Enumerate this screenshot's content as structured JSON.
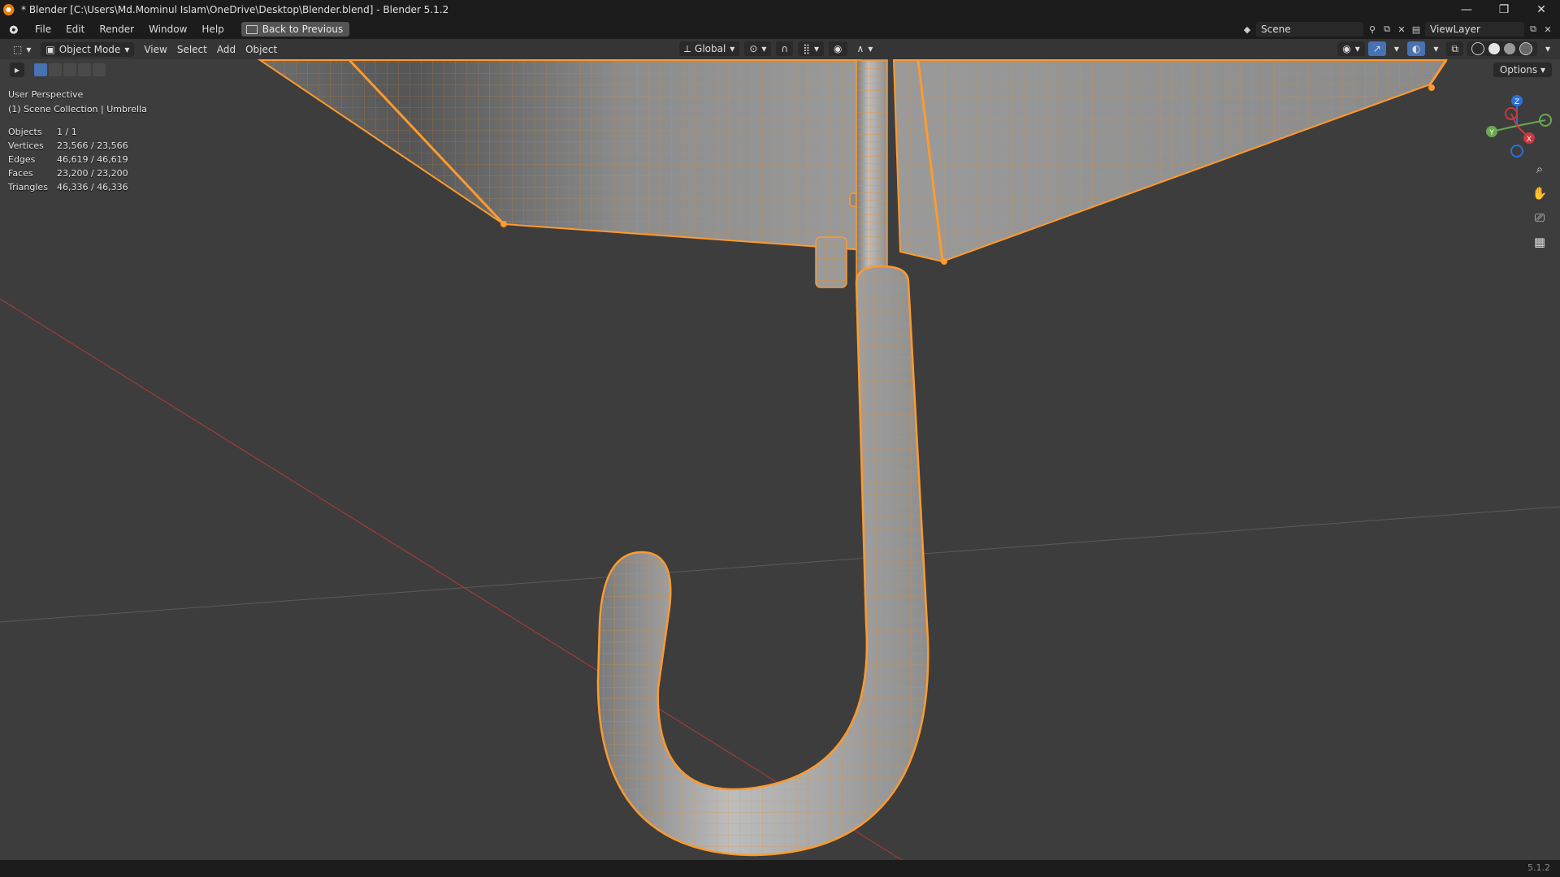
{
  "window": {
    "title": "* Blender [C:\\Users\\Md.Mominul Islam\\OneDrive\\Desktop\\Blender.blend] - Blender 5.1.2"
  },
  "menu": {
    "items": [
      "File",
      "Edit",
      "Render",
      "Window",
      "Help"
    ],
    "back_button": "Back to Previous"
  },
  "top_right": {
    "scene": "Scene",
    "view_layer": "ViewLayer"
  },
  "viewport_header": {
    "mode": "Object Mode",
    "items": [
      "View",
      "Select",
      "Add",
      "Object"
    ],
    "transform_orientation": "Global",
    "options": "Options"
  },
  "overlay": {
    "perspective": "User Perspective",
    "collection": "(1) Scene Collection | Umbrella"
  },
  "stats": [
    {
      "label": "Objects",
      "value": "1 / 1"
    },
    {
      "label": "Vertices",
      "value": "23,566 / 23,566"
    },
    {
      "label": "Edges",
      "value": "46,619 / 46,619"
    },
    {
      "label": "Faces",
      "value": "23,200 / 23,200"
    },
    {
      "label": "Triangles",
      "value": "46,336 / 46,336"
    }
  ],
  "status": {
    "version": "5.1.2"
  },
  "colors": {
    "accent": "#e87d0d",
    "selection": "#ff9a2e",
    "background": "#3d3d3d",
    "header": "#1c1c1c"
  }
}
